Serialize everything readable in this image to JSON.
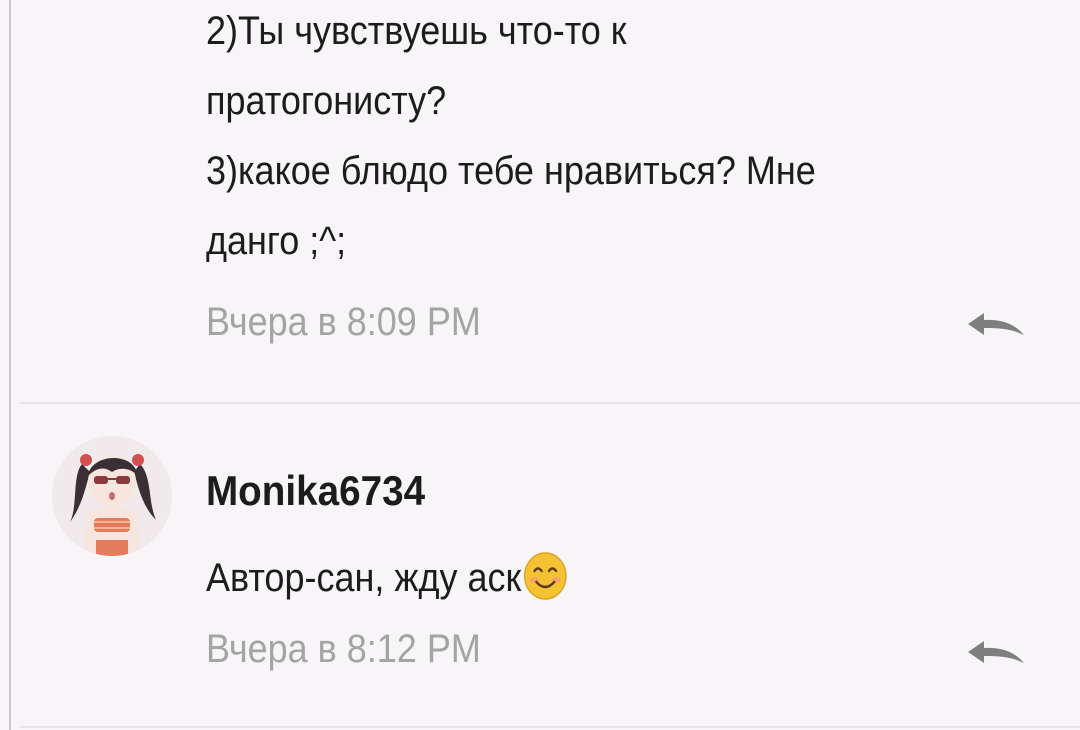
{
  "comments": [
    {
      "lines": [
        "2)Ты чувствуешь что-то к",
        "пратогонисту?",
        "3)какое блюдо тебе нравиться? Мне",
        "данго ;^;"
      ],
      "timestamp": "Вчера в 8:09 PM"
    },
    {
      "username": "Monika6734",
      "text": "Автор-сан, жду аск",
      "emoji": "smiling-face-emoji",
      "timestamp": "Вчера в 8:12 PM"
    }
  ],
  "icons": {
    "reply": "reply-arrow-icon",
    "avatar": "user-avatar"
  },
  "colors": {
    "background": "#f7f5f7",
    "text": "#1c1c1c",
    "timestamp": "#a4a4a4",
    "reply_icon": "#7f7f7f",
    "emoji": "#f5c234"
  }
}
